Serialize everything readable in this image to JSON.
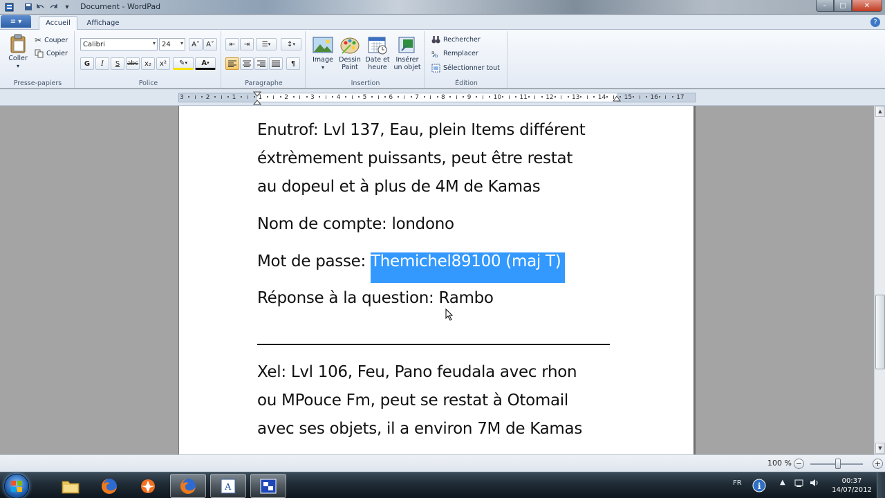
{
  "window": {
    "title": "Document - WordPad",
    "min_symbol": "–",
    "max_symbol": "□",
    "close_symbol": "✕"
  },
  "tabs": {
    "app_menu": "≡ ▾",
    "home": "Accueil",
    "view": "Affichage",
    "help": "?"
  },
  "ribbon": {
    "clipboard": {
      "label": "Presse-papiers",
      "paste": "Coller",
      "cut": "Couper",
      "copy": "Copier"
    },
    "font": {
      "label": "Police",
      "family": "Calibri",
      "size": "24",
      "grow": "A˄",
      "shrink": "A˅",
      "bold": "G",
      "italic": "I",
      "underline": "S",
      "strike": "abc",
      "subscript": "x₂",
      "superscript": "x²",
      "highlight": "✎",
      "color": "A"
    },
    "paragraph": {
      "label": "Paragraphe"
    },
    "insert": {
      "label": "Insertion",
      "image": "Image",
      "paint_line1": "Dessin",
      "paint_line2": "Paint",
      "datetime_line1": "Date et",
      "datetime_line2": "heure",
      "object_line1": "Insérer",
      "object_line2": "un objet"
    },
    "editing": {
      "label": "Édition",
      "find": "Rechercher",
      "replace": "Remplacer",
      "select_all": "Sélectionner tout"
    }
  },
  "ruler": {
    "ticks": [
      "3",
      "2",
      "1",
      "1",
      "2",
      "3",
      "4",
      "5",
      "6",
      "7",
      "8",
      "9",
      "10",
      "11",
      "12",
      "13",
      "14",
      "15",
      "16",
      "17"
    ]
  },
  "document": {
    "lines": [
      "Enutrof: Lvl 137, Eau, plein Items différent",
      "éxtrèmement puissants, peut être restat",
      "au dopeul et à plus de 4M de Kamas"
    ],
    "account_line": "Nom de compte: londono",
    "password_label": "Mot de passe: ",
    "password_selected": "Themichel89100 (maj T)",
    "answer_line": "Réponse à la question: Rambo",
    "lines2": [
      "Xel: Lvl 106, Feu, Pano feudala avec rhon",
      "ou MPouce Fm, peut se restat à Otomail",
      "avec ses objets, il a environ 7M de Kamas"
    ]
  },
  "statusbar": {
    "zoom": "100 %",
    "zoom_out": "−",
    "zoom_in": "+"
  },
  "taskbar": {
    "language": "FR",
    "time": "00:37",
    "date": "14/07/2012"
  },
  "colors": {
    "selection": "#3399ff",
    "ribbon_bg": "#e3eaf4"
  }
}
